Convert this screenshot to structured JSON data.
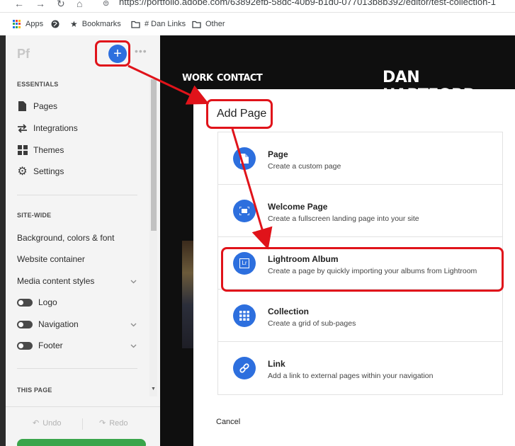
{
  "browser": {
    "url": "https://portfolio.adobe.com/63892efb-58dc-40b9-b1d0-077013b8b392/editor/test-collection-1",
    "bookmarks": [
      {
        "label": "Apps",
        "icon": "apps-grid-icon"
      },
      {
        "label": "",
        "icon": "globe-icon"
      },
      {
        "label": "Bookmarks",
        "icon": "star-icon"
      },
      {
        "label": "# Dan Links",
        "icon": "folder-icon"
      },
      {
        "label": "Other",
        "icon": "folder-icon"
      }
    ]
  },
  "sidebar": {
    "logo": "Pf",
    "add_button": "+",
    "more": "•••",
    "essentials_heading": "ESSENTIALS",
    "essentials": [
      {
        "label": "Pages",
        "icon": "page-icon"
      },
      {
        "label": "Integrations",
        "icon": "integrations-icon"
      },
      {
        "label": "Themes",
        "icon": "themes-grid-icon"
      },
      {
        "label": "Settings",
        "icon": "gear-icon"
      }
    ],
    "sitewide_heading": "SITE-WIDE",
    "sitewide": [
      {
        "label": "Background, colors & font"
      },
      {
        "label": "Website container"
      },
      {
        "label": "Media content styles"
      }
    ],
    "toggles": [
      {
        "label": "Logo"
      },
      {
        "label": "Navigation"
      },
      {
        "label": "Footer"
      }
    ],
    "this_page_heading": "THIS PAGE",
    "undo": "Undo",
    "redo": "Redo"
  },
  "preview": {
    "nav": [
      "WORK",
      "CONTACT"
    ],
    "site_name": "DAN HARTFORD"
  },
  "modal": {
    "title": "Add Page",
    "options": [
      {
        "name": "Page",
        "desc": "Create a custom page",
        "icon": "page-icon"
      },
      {
        "name": "Welcome Page",
        "desc": "Create a fullscreen landing page into your site",
        "icon": "fullscreen-icon"
      },
      {
        "name": "Lightroom Album",
        "desc": "Create a page by quickly importing your albums from Lightroom",
        "icon": "lightroom-icon",
        "icon_text": "Lr"
      },
      {
        "name": "Collection",
        "desc": "Create a grid of sub-pages",
        "icon": "grid-icon"
      },
      {
        "name": "Link",
        "desc": "Add a link to external pages within your navigation",
        "icon": "link-icon"
      }
    ],
    "cancel": "Cancel"
  },
  "colors": {
    "accent": "#2d6fde",
    "annotation": "#e0131a",
    "publish": "#3aa54b"
  }
}
